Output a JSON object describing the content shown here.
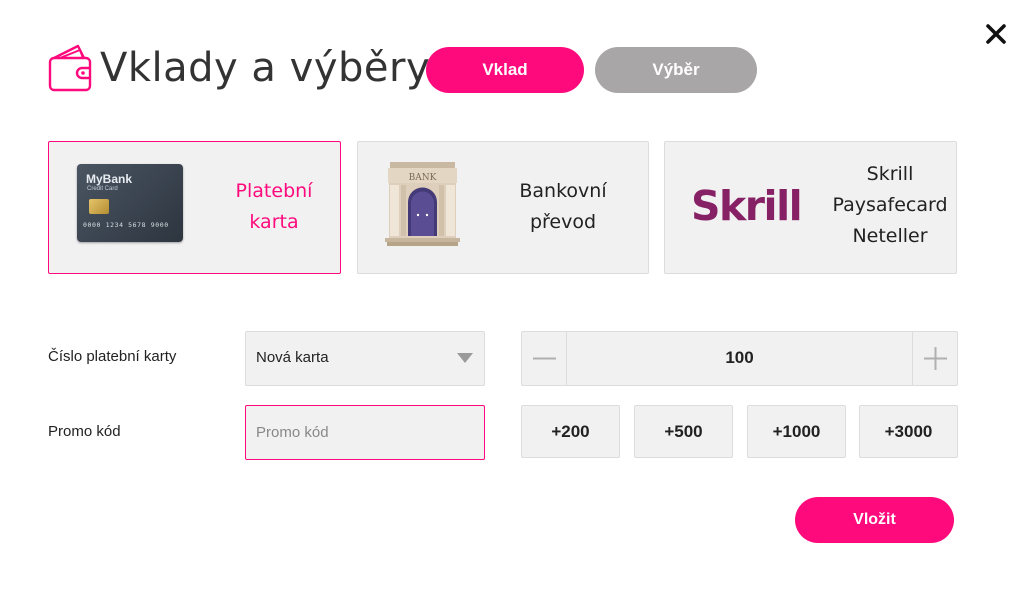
{
  "header": {
    "title": "Vklady a výběry",
    "icon": "wallet-icon"
  },
  "tabs": [
    {
      "label": "Vklad",
      "active": true
    },
    {
      "label": "Výběr",
      "active": false
    }
  ],
  "payment_methods": [
    {
      "id": "card",
      "lines": [
        "Platební",
        "karta"
      ],
      "active": true,
      "image": "credit-card",
      "card": {
        "bank": "MyBank",
        "subtitle": "Credit Card",
        "number": "0000 1234 5678 9000"
      }
    },
    {
      "id": "bank",
      "lines": [
        "Bankovní",
        "převod"
      ],
      "active": false,
      "image": "bank-building-icon",
      "bank_sign": "BANK"
    },
    {
      "id": "ewallet",
      "lines": [
        "Skrill",
        "Paysafecard",
        "Neteller"
      ],
      "active": false,
      "logo": "Skrill"
    }
  ],
  "form": {
    "card_label": "Číslo platební karty",
    "card_select_value": "Nová karta",
    "promo_label": "Promo kód",
    "promo_placeholder": "Promo kód",
    "promo_value": ""
  },
  "amount": {
    "value": "100",
    "minus_icon": "minus-icon",
    "plus_icon": "plus-icon",
    "quick_amounts": [
      "+200",
      "+500",
      "+1000",
      "+3000"
    ]
  },
  "submit_label": "Vložit",
  "colors": {
    "accent": "#ff0a7d",
    "inactive_tab": "#a8a6a6",
    "panel_bg": "#f1f1f1",
    "skrill": "#862165"
  }
}
